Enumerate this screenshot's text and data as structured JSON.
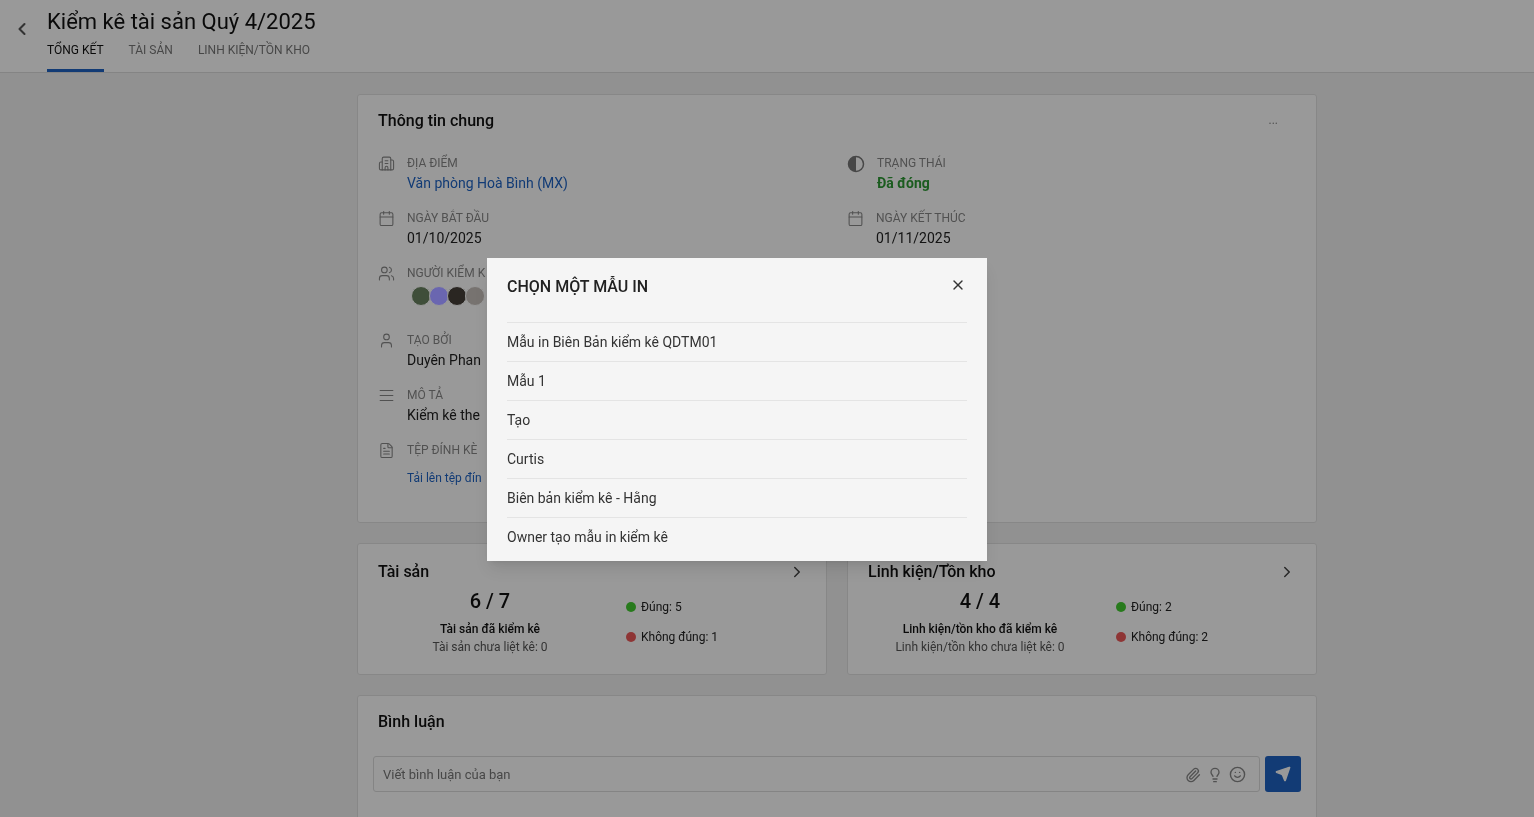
{
  "header": {
    "title": "Kiểm kê tài sản Quý 4/2025",
    "tabs": [
      {
        "label": "TỔNG KẾT",
        "selected": true
      },
      {
        "label": "TÀI SẢN",
        "selected": false
      },
      {
        "label": "LINH KIỆN/TỒN KHO",
        "selected": false
      }
    ]
  },
  "info_card": {
    "title": "Thông tin chung",
    "more": "...",
    "left_fields": [
      {
        "kind": "location",
        "label": "ĐỊA ĐIỂM",
        "value": "Văn phòng Hoà Bình (MX)"
      },
      {
        "kind": "calendar",
        "label": "NGÀY BẮT ĐẦU",
        "value": "01/10/2025"
      },
      {
        "kind": "people",
        "label": "NGƯỜI KIỂM K",
        "avatars": [
          {
            "color": "#3f4e3a"
          },
          {
            "color": "#6a66b0"
          },
          {
            "color": "#2a2622"
          },
          {
            "color": "#777370"
          }
        ]
      },
      {
        "kind": "person",
        "label": "TẠO BỞI",
        "value": "Duyên Phan"
      },
      {
        "kind": "text",
        "label": "MÔ TẢ",
        "value": "Kiểm kê the"
      },
      {
        "kind": "file",
        "label": "TỆP ĐÍNH KÈ",
        "value": "Tải lên tệp đín"
      }
    ],
    "right_fields": [
      {
        "kind": "status",
        "label": "TRẠNG THÁI",
        "value": "Đã đóng"
      },
      {
        "kind": "calendar",
        "label": "NGÀY KẾT THÚC",
        "value": "01/11/2025"
      }
    ]
  },
  "summary_cards": [
    {
      "title": "Tài sản",
      "ratio": "6 / 7",
      "counted": "Tài sản đã kiểm kê",
      "unlisted": "Tài sản chưa liệt kê: 0",
      "legend": [
        {
          "label": "Đúng: 5",
          "color": "#277a1c"
        },
        {
          "label": "Không đúng: 1",
          "color": "#8e3535"
        }
      ]
    },
    {
      "title": "Linh kiện/Tồn kho",
      "ratio": "4 / 4",
      "counted": "Linh kiện/tồn kho đã kiểm kê",
      "unlisted": "Linh kiện/tồn kho chưa liệt kê: 0",
      "legend": [
        {
          "label": "Đúng: 2",
          "color": "#277a1c"
        },
        {
          "label": "Không đúng: 2",
          "color": "#8e3535"
        }
      ]
    }
  ],
  "comments": {
    "title": "Bình luận",
    "placeholder": "Viết bình luận của bạn"
  },
  "dialog": {
    "title": "CHỌN MỘT MẪU IN",
    "items": [
      "Mẫu in Biên Bản kiểm kê QDTM01",
      "Mẫu 1",
      "Tạo",
      "Curtis",
      "Biên bản kiểm kê - Hằng",
      "Owner tạo mẫu in kiểm kê"
    ]
  }
}
